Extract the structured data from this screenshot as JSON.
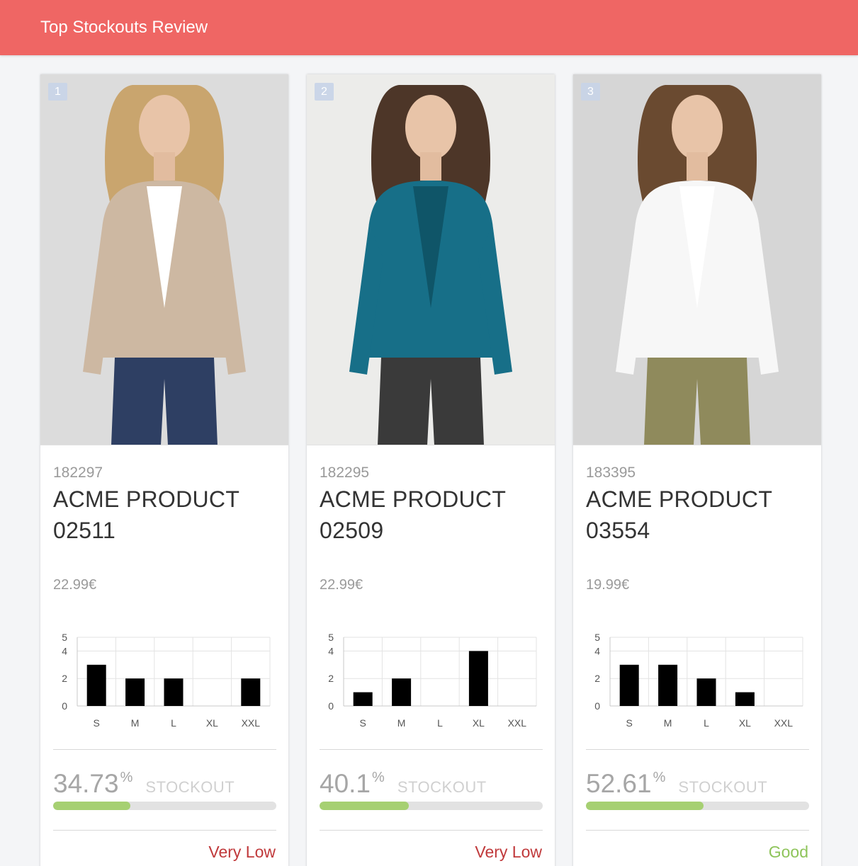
{
  "header": {
    "title": "Top Stockouts Review"
  },
  "colors": {
    "header_bg": "#ef6664",
    "progress_fill": "#a6d072",
    "rating_low": "#c0393b",
    "rating_good": "#8ec45a"
  },
  "products": [
    {
      "rank": "1",
      "sku": "182297",
      "name": "ACME PRODUCT 02511",
      "price": "22.99€",
      "stockout_value": "34.73",
      "stockout_unit": "%",
      "stockout_label": "STOCKOUT",
      "stockout_fraction": 0.3473,
      "rating": "Very Low",
      "rating_color": "#c0393b",
      "photo": {
        "description_icon": "model-photo",
        "bg": "#dcdcdc",
        "top": "#cdb8a2",
        "inner": "#ffffff",
        "bottom": "#2e3f63",
        "hair": "#c9a56e"
      },
      "chart_data": {
        "type": "bar",
        "categories": [
          "S",
          "M",
          "L",
          "XL",
          "XXL"
        ],
        "values": [
          3,
          2,
          2,
          0,
          2
        ],
        "yticks": [
          "5",
          "4",
          "2",
          "0"
        ],
        "ylim": [
          0,
          5
        ],
        "grid": true
      }
    },
    {
      "rank": "2",
      "sku": "182295",
      "name": "ACME PRODUCT 02509",
      "price": "22.99€",
      "stockout_value": "40.1",
      "stockout_unit": "%",
      "stockout_label": "STOCKOUT",
      "stockout_fraction": 0.401,
      "rating": "Very Low",
      "rating_color": "#c0393b",
      "photo": {
        "description_icon": "model-photo",
        "bg": "#ececea",
        "top": "#176f88",
        "inner": "#0f5568",
        "bottom": "#3a3a3a",
        "hair": "#4d3628"
      },
      "chart_data": {
        "type": "bar",
        "categories": [
          "S",
          "M",
          "L",
          "XL",
          "XXL"
        ],
        "values": [
          1,
          2,
          0,
          4,
          0
        ],
        "yticks": [
          "5",
          "4",
          "2",
          "0"
        ],
        "ylim": [
          0,
          5
        ],
        "grid": true
      }
    },
    {
      "rank": "3",
      "sku": "183395",
      "name": "ACME PRODUCT 03554",
      "price": "19.99€",
      "stockout_value": "52.61",
      "stockout_unit": "%",
      "stockout_label": "STOCKOUT",
      "stockout_fraction": 0.5261,
      "rating": "Good",
      "rating_color": "#8ec45a",
      "photo": {
        "description_icon": "model-photo",
        "bg": "#d6d6d6",
        "top": "#f7f7f7",
        "inner": "#ffffff",
        "bottom": "#8f8a5c",
        "hair": "#6a4a30"
      },
      "chart_data": {
        "type": "bar",
        "categories": [
          "S",
          "M",
          "L",
          "XL",
          "XXL"
        ],
        "values": [
          3,
          3,
          2,
          1,
          0
        ],
        "yticks": [
          "5",
          "4",
          "2",
          "0"
        ],
        "ylim": [
          0,
          5
        ],
        "grid": true
      }
    }
  ]
}
